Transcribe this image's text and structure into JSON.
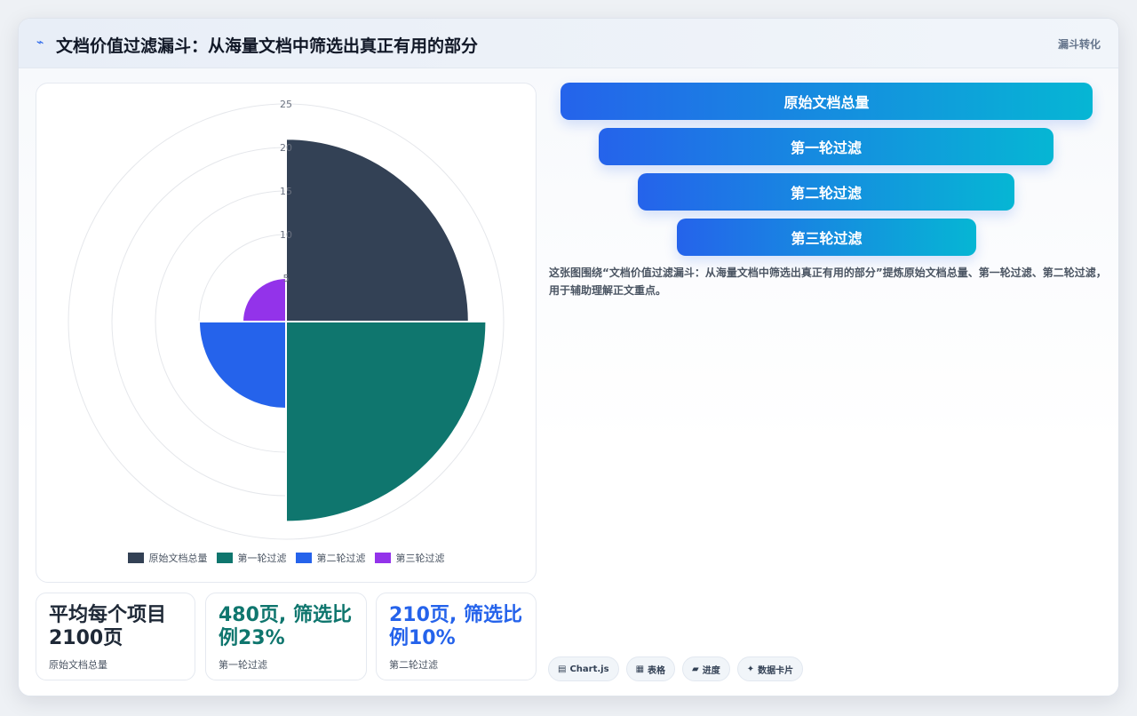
{
  "header": {
    "title": "文档价值过滤漏斗：从海量文档中筛选出真正有用的部分",
    "tag": "漏斗转化",
    "icon": "chart-line-icon"
  },
  "chart_data": {
    "type": "polarArea",
    "categories": [
      "原始文档总量",
      "第一轮过滤",
      "第二轮过滤",
      "第三轮过滤"
    ],
    "values": [
      21,
      23,
      10,
      5
    ],
    "colors": [
      "#334155",
      "#0f766e",
      "#2563eb",
      "#9333ea"
    ],
    "r_ticks": [
      "5",
      "10",
      "15",
      "20",
      "25"
    ],
    "r_max": 25,
    "legend_position": "bottom"
  },
  "stats": [
    {
      "value": "平均每个项目2100页",
      "label": "原始文档总量",
      "color": "#1f2937"
    },
    {
      "value": "480页, 筛选比例23%",
      "label": "第一轮过滤",
      "color": "#0f766e"
    },
    {
      "value": "210页, 筛选比例10%",
      "label": "第二轮过滤",
      "color": "#2563eb"
    }
  ],
  "funnel": [
    "原始文档总量",
    "第一轮过滤",
    "第二轮过滤",
    "第三轮过滤"
  ],
  "description": "这张图围绕“文档价值过滤漏斗：从海量文档中筛选出真正有用的部分”提炼原始文档总量、第一轮过滤、第二轮过滤，用于辅助理解正文重点。",
  "chips": [
    {
      "icon": "chart-icon",
      "glyph": "▤",
      "label": "Chart.js"
    },
    {
      "icon": "table-icon",
      "glyph": "▦",
      "label": "表格"
    },
    {
      "icon": "progress-icon",
      "glyph": "▰",
      "label": "进度"
    },
    {
      "icon": "data-card-icon",
      "glyph": "✦",
      "label": "数据卡片"
    }
  ]
}
